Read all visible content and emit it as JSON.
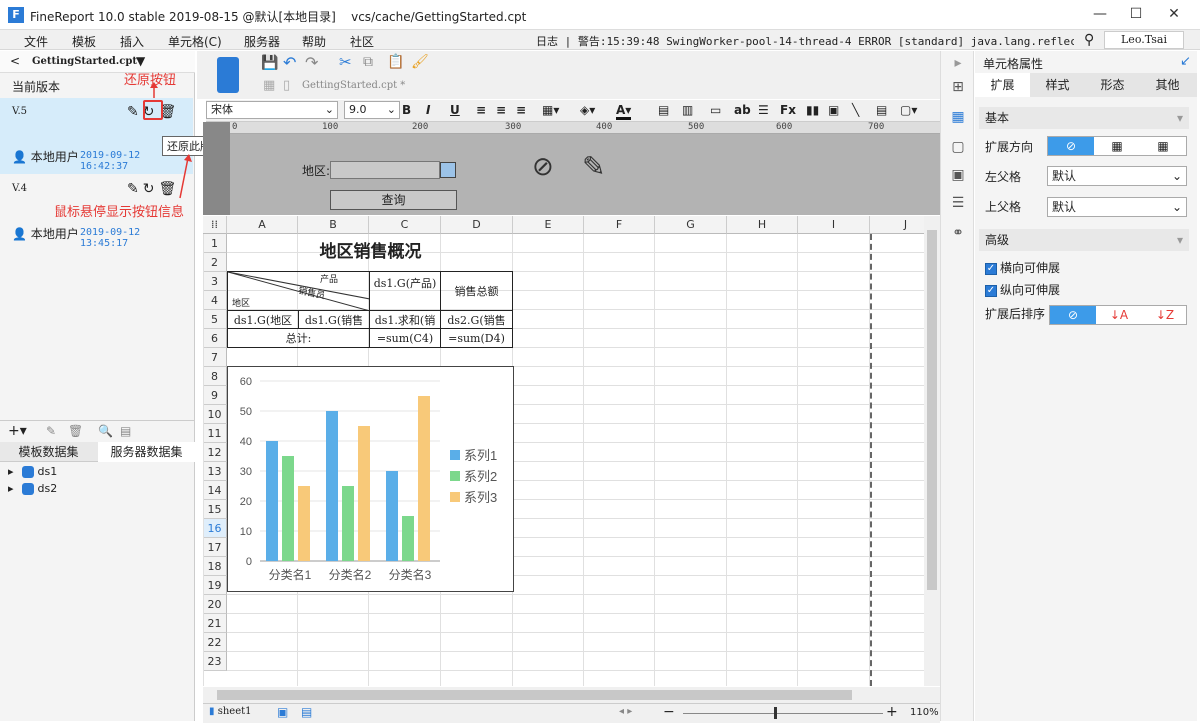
{
  "window": {
    "title": "FineReport 10.0 stable 2019-08-15 @默认[本地目录]    vcs/cache/GettingStarted.cpt",
    "minimize": "—",
    "maximize": "☐",
    "close": "✕"
  },
  "menu": [
    "文件",
    "模板",
    "插入",
    "单元格(C)",
    "服务器",
    "帮助",
    "社区"
  ],
  "log": "日志 | 警告:15:39:48 SwingWorker-pool-14-thread-4 ERROR [standard] java.lang.reflect.InvocationTa…",
  "user": "Leo.Tsai",
  "left": {
    "file": "GettingStarted.cpt",
    "current_version": "当前版本",
    "versions": [
      {
        "name": "V.5",
        "user": "本地用户",
        "time": "2019-09-12 16:42:37"
      },
      {
        "name": "V.4",
        "user": "本地用户",
        "time": "2019-09-12 13:45:17"
      }
    ],
    "annotations": {
      "restore_button": "还原按钮",
      "hover_info": "鼠标悬停显示按钮信息",
      "tooltip": "还原此版本"
    },
    "dataset_tabs": [
      "模板数据集",
      "服务器数据集"
    ],
    "datasets": [
      "ds1",
      "ds2"
    ]
  },
  "editor": {
    "tab": "GettingStarted.cpt *",
    "font": "宋体",
    "size": "9.0"
  },
  "ruler": [
    "0",
    "100",
    "200",
    "300",
    "400",
    "500",
    "600",
    "700"
  ],
  "param": {
    "label": "地区:",
    "query": "查询"
  },
  "columns": [
    "A",
    "B",
    "C",
    "D",
    "E",
    "F",
    "G",
    "H",
    "I",
    "J"
  ],
  "rows": [
    "1",
    "2",
    "3",
    "4",
    "5",
    "6",
    "7",
    "8",
    "9",
    "10",
    "11",
    "12",
    "13",
    "14",
    "15",
    "16",
    "17",
    "18",
    "19",
    "20",
    "21",
    "22",
    "23"
  ],
  "report": {
    "title": "地区销售概况",
    "h_product": "产品",
    "h_person": "销售员",
    "h_region": "地区",
    "c3": "ds1.G(产品)",
    "d3": "销售总额",
    "a4": "ds1.G(地区",
    "b4": "ds1.G(销售",
    "c4": "ds1.求和(销",
    "d4": "ds2.G(销售",
    "a5": "总计:",
    "c5": "=sum(C4)",
    "d5": "=sum(D4)"
  },
  "chart_data": {
    "type": "bar",
    "categories": [
      "分类名1",
      "分类名2",
      "分类名3"
    ],
    "series": [
      {
        "name": "系列1",
        "values": [
          40,
          50,
          30
        ],
        "color": "#5aaee8"
      },
      {
        "name": "系列2",
        "values": [
          35,
          25,
          15
        ],
        "color": "#7cd88c"
      },
      {
        "name": "系列3",
        "values": [
          25,
          45,
          55
        ],
        "color": "#f8c979"
      }
    ],
    "ylim": [
      0,
      60
    ],
    "yticks": [
      "0",
      "10",
      "20",
      "30",
      "40",
      "50",
      "60"
    ],
    "legend": "right"
  },
  "sheet": "sheet1",
  "zoom": "110%",
  "right": {
    "title": "单元格属性",
    "tabs": [
      "扩展",
      "样式",
      "形态",
      "其他"
    ],
    "basic": "基本",
    "expand_dir": "扩展方向",
    "left_parent": "左父格",
    "top_parent": "上父格",
    "default1": "默认",
    "default2": "默认",
    "advanced": "高级",
    "h_expand": "横向可伸展",
    "v_expand": "纵向可伸展",
    "sort": "扩展后排序"
  }
}
